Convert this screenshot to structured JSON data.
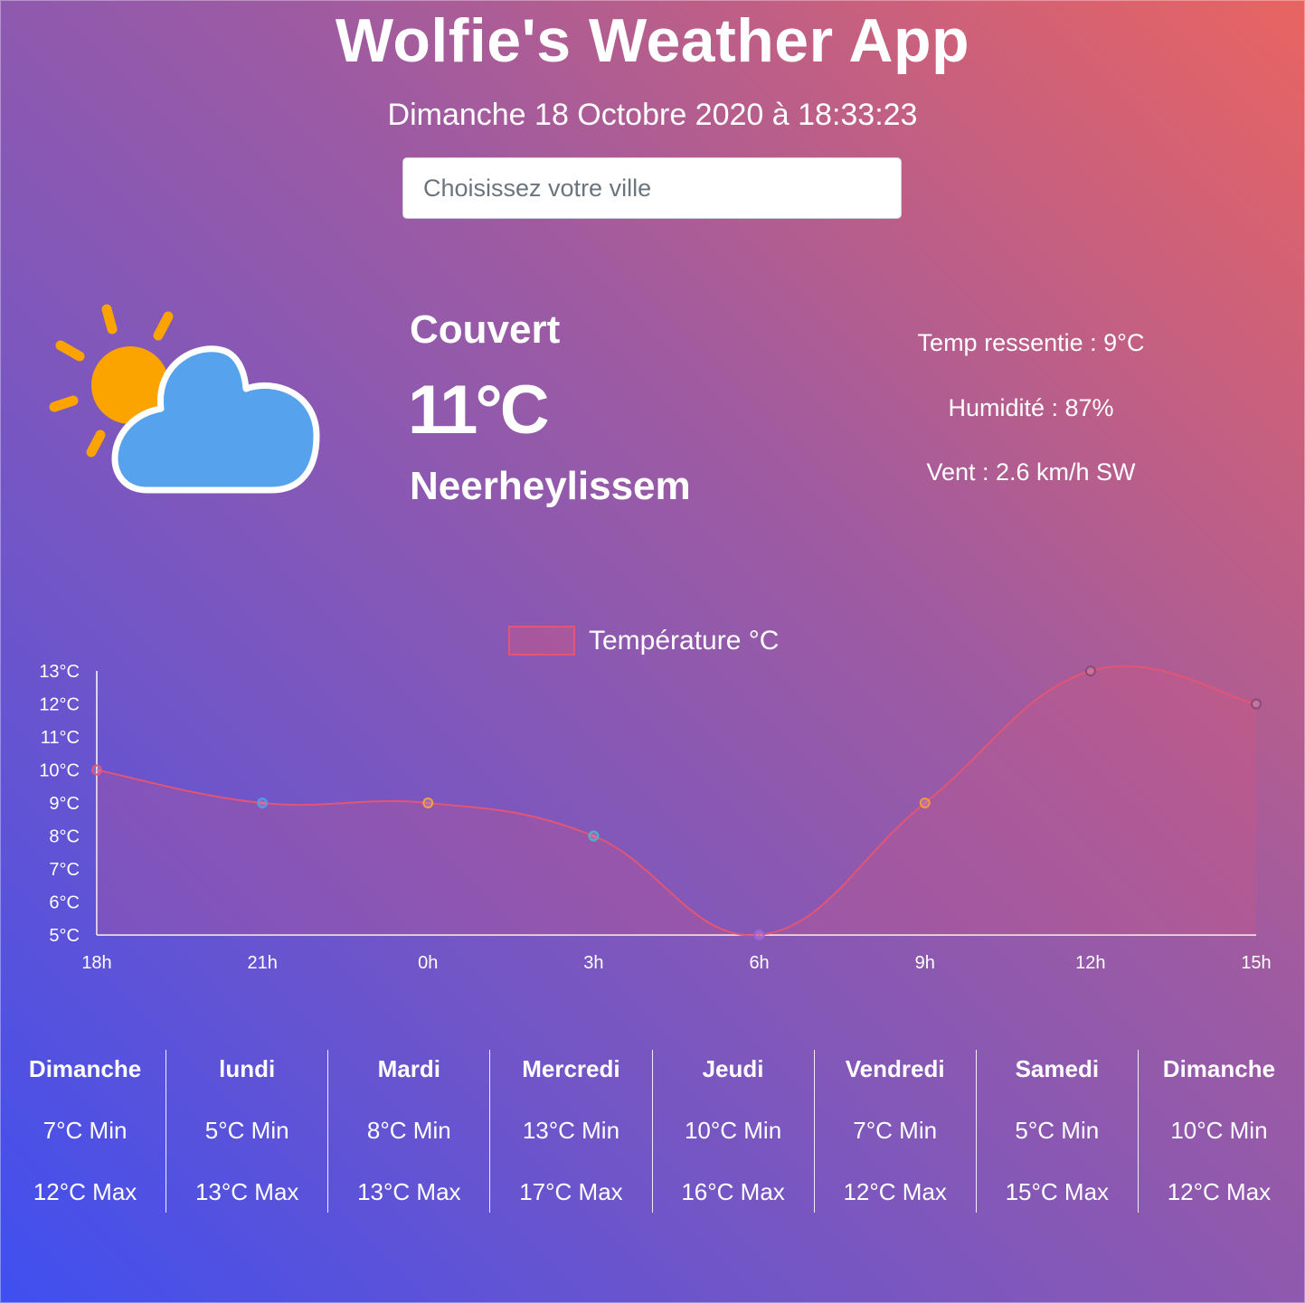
{
  "header": {
    "title": "Wolfie's Weather App",
    "datetime": "Dimanche 18 Octobre 2020 à 18:33:23"
  },
  "search": {
    "placeholder": "Choisissez votre ville"
  },
  "current": {
    "icon": "partly-cloudy-icon",
    "condition": "Couvert",
    "temperature": "11°C",
    "city": "Neerheylissem",
    "feels_like": "Temp ressentie : 9°C",
    "humidity": "Humidité : 87%",
    "wind": "Vent : 2.6 km/h SW"
  },
  "colors": {
    "sun": "#fba400",
    "cloud": "#57a2ec",
    "line": "#e25575"
  },
  "chart_data": {
    "type": "line",
    "legend": "Température °C",
    "legend_placement": "top-center",
    "categories": [
      "18h",
      "21h",
      "0h",
      "3h",
      "6h",
      "9h",
      "12h",
      "15h"
    ],
    "series": [
      {
        "name": "Température °C",
        "values": [
          10,
          9,
          9,
          8,
          5,
          9,
          13,
          12
        ]
      }
    ],
    "point_colors": [
      "#e25575",
      "#4a9fe8",
      "#f5a23c",
      "#46b7c4",
      "#9c5fe6",
      "#f59a3a",
      "#8a4a78",
      "#8a4a78"
    ],
    "ylim": [
      5,
      13
    ],
    "yticks": [
      "5°C",
      "6°C",
      "7°C",
      "8°C",
      "9°C",
      "10°C",
      "11°C",
      "12°C",
      "13°C"
    ],
    "fill": true,
    "grid": false
  },
  "forecast": [
    {
      "day": "Dimanche",
      "min": "7°C Min",
      "max": "12°C Max"
    },
    {
      "day": "lundi",
      "min": "5°C Min",
      "max": "13°C Max"
    },
    {
      "day": "Mardi",
      "min": "8°C Min",
      "max": "13°C Max"
    },
    {
      "day": "Mercredi",
      "min": "13°C Min",
      "max": "17°C Max"
    },
    {
      "day": "Jeudi",
      "min": "10°C Min",
      "max": "16°C Max"
    },
    {
      "day": "Vendredi",
      "min": "7°C Min",
      "max": "12°C Max"
    },
    {
      "day": "Samedi",
      "min": "5°C Min",
      "max": "15°C Max"
    },
    {
      "day": "Dimanche",
      "min": "10°C Min",
      "max": "12°C Max"
    }
  ]
}
